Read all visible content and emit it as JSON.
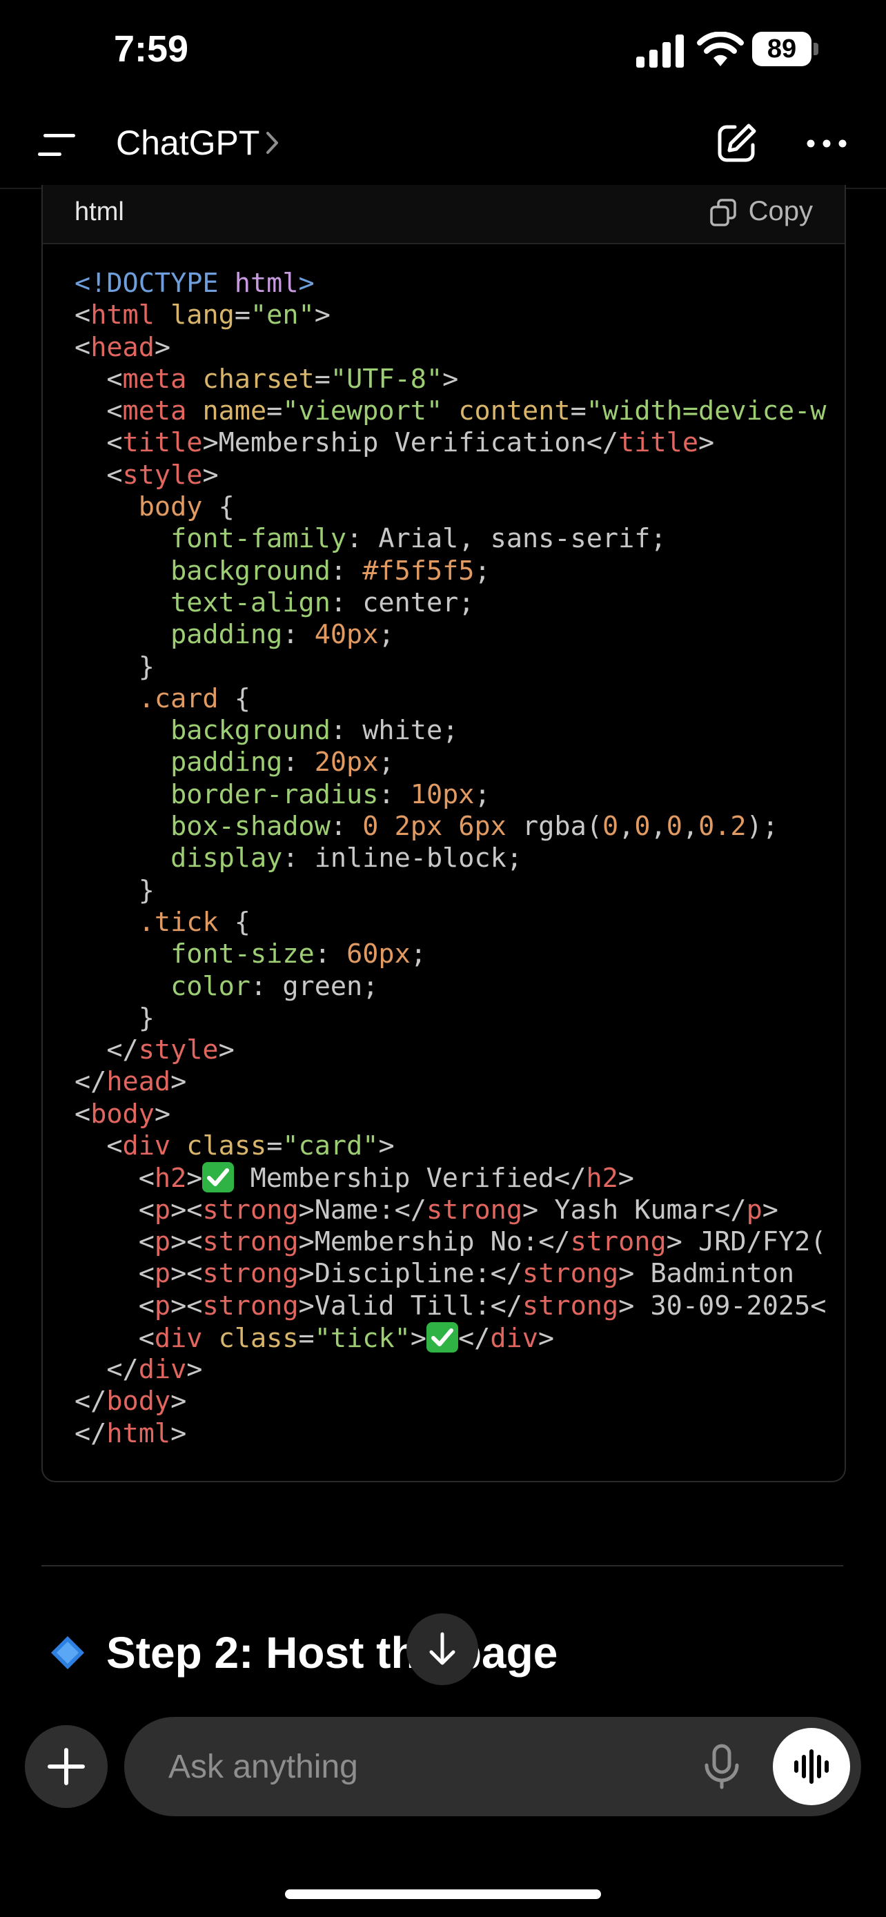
{
  "status_bar": {
    "time": "7:59",
    "battery": "89"
  },
  "header": {
    "title": "ChatGPT"
  },
  "code_block": {
    "language": "html",
    "copy_label": "Copy",
    "lines": [
      [
        [
          "t-doct",
          "<!DOCTYPE "
        ],
        [
          "t-kw",
          "html"
        ],
        [
          "t-doct",
          ">"
        ]
      ],
      [
        [
          "t-txt",
          "<"
        ],
        [
          "t-tag",
          "html"
        ],
        [
          "t-txt",
          " "
        ],
        [
          "t-attr",
          "lang"
        ],
        [
          "t-txt",
          "="
        ],
        [
          "t-str",
          "\"en\""
        ],
        [
          "t-txt",
          ">"
        ]
      ],
      [
        [
          "t-txt",
          "<"
        ],
        [
          "t-tag",
          "head"
        ],
        [
          "t-txt",
          ">"
        ]
      ],
      [
        [
          "t-txt",
          "  <"
        ],
        [
          "t-tag",
          "meta"
        ],
        [
          "t-txt",
          " "
        ],
        [
          "t-attr",
          "charset"
        ],
        [
          "t-txt",
          "="
        ],
        [
          "t-str",
          "\"UTF-8\""
        ],
        [
          "t-txt",
          ">"
        ]
      ],
      [
        [
          "t-txt",
          "  <"
        ],
        [
          "t-tag",
          "meta"
        ],
        [
          "t-txt",
          " "
        ],
        [
          "t-attr",
          "name"
        ],
        [
          "t-txt",
          "="
        ],
        [
          "t-str",
          "\"viewport\""
        ],
        [
          "t-txt",
          " "
        ],
        [
          "t-attr",
          "content"
        ],
        [
          "t-txt",
          "="
        ],
        [
          "t-str",
          "\"width=device-w"
        ]
      ],
      [
        [
          "t-txt",
          "  <"
        ],
        [
          "t-tag",
          "title"
        ],
        [
          "t-txt",
          ">Membership Verification</"
        ],
        [
          "t-tag",
          "title"
        ],
        [
          "t-txt",
          ">"
        ]
      ],
      [
        [
          "t-txt",
          "  <"
        ],
        [
          "t-tag",
          "style"
        ],
        [
          "t-txt",
          ">"
        ]
      ],
      [
        [
          "t-txt",
          "    "
        ],
        [
          "t-sel",
          "body"
        ],
        [
          "t-txt",
          " {"
        ]
      ],
      [
        [
          "t-txt",
          "      "
        ],
        [
          "t-prop",
          "font-family"
        ],
        [
          "t-txt",
          ": Arial, sans-serif;"
        ]
      ],
      [
        [
          "t-txt",
          "      "
        ],
        [
          "t-prop",
          "background"
        ],
        [
          "t-txt",
          ": "
        ],
        [
          "t-num",
          "#f5f5f5"
        ],
        [
          "t-txt",
          ";"
        ]
      ],
      [
        [
          "t-txt",
          "      "
        ],
        [
          "t-prop",
          "text-align"
        ],
        [
          "t-txt",
          ": center;"
        ]
      ],
      [
        [
          "t-txt",
          "      "
        ],
        [
          "t-prop",
          "padding"
        ],
        [
          "t-txt",
          ": "
        ],
        [
          "t-num",
          "40px"
        ],
        [
          "t-txt",
          ";"
        ]
      ],
      [
        [
          "t-txt",
          "    }"
        ]
      ],
      [
        [
          "t-txt",
          "    "
        ],
        [
          "t-sel",
          ".card"
        ],
        [
          "t-txt",
          " {"
        ]
      ],
      [
        [
          "t-txt",
          "      "
        ],
        [
          "t-prop",
          "background"
        ],
        [
          "t-txt",
          ": white;"
        ]
      ],
      [
        [
          "t-txt",
          "      "
        ],
        [
          "t-prop",
          "padding"
        ],
        [
          "t-txt",
          ": "
        ],
        [
          "t-num",
          "20px"
        ],
        [
          "t-txt",
          ";"
        ]
      ],
      [
        [
          "t-txt",
          "      "
        ],
        [
          "t-prop",
          "border-radius"
        ],
        [
          "t-txt",
          ": "
        ],
        [
          "t-num",
          "10px"
        ],
        [
          "t-txt",
          ";"
        ]
      ],
      [
        [
          "t-txt",
          "      "
        ],
        [
          "t-prop",
          "box-shadow"
        ],
        [
          "t-txt",
          ": "
        ],
        [
          "t-num",
          "0 2px 6px"
        ],
        [
          "t-txt",
          " rgba("
        ],
        [
          "t-num",
          "0"
        ],
        [
          "t-txt",
          ","
        ],
        [
          "t-num",
          "0"
        ],
        [
          "t-txt",
          ","
        ],
        [
          "t-num",
          "0"
        ],
        [
          "t-txt",
          ","
        ],
        [
          "t-num",
          "0.2"
        ],
        [
          "t-txt",
          ");"
        ]
      ],
      [
        [
          "t-txt",
          "      "
        ],
        [
          "t-prop",
          "display"
        ],
        [
          "t-txt",
          ": inline-block;"
        ]
      ],
      [
        [
          "t-txt",
          "    }"
        ]
      ],
      [
        [
          "t-txt",
          "    "
        ],
        [
          "t-sel",
          ".tick"
        ],
        [
          "t-txt",
          " {"
        ]
      ],
      [
        [
          "t-txt",
          "      "
        ],
        [
          "t-prop",
          "font-size"
        ],
        [
          "t-txt",
          ": "
        ],
        [
          "t-num",
          "60px"
        ],
        [
          "t-txt",
          ";"
        ]
      ],
      [
        [
          "t-txt",
          "      "
        ],
        [
          "t-prop",
          "color"
        ],
        [
          "t-txt",
          ": green;"
        ]
      ],
      [
        [
          "t-txt",
          "    }"
        ]
      ],
      [
        [
          "t-txt",
          "  </"
        ],
        [
          "t-tag",
          "style"
        ],
        [
          "t-txt",
          ">"
        ]
      ],
      [
        [
          "t-txt",
          "</"
        ],
        [
          "t-tag",
          "head"
        ],
        [
          "t-txt",
          ">"
        ]
      ],
      [
        [
          "t-txt",
          "<"
        ],
        [
          "t-tag",
          "body"
        ],
        [
          "t-txt",
          ">"
        ]
      ],
      [
        [
          "t-txt",
          "  <"
        ],
        [
          "t-tag",
          "div"
        ],
        [
          "t-txt",
          " "
        ],
        [
          "t-attr",
          "class"
        ],
        [
          "t-txt",
          "="
        ],
        [
          "t-str",
          "\"card\""
        ],
        [
          "t-txt",
          ">"
        ]
      ],
      [
        [
          "t-txt",
          "    <"
        ],
        [
          "t-tag",
          "h2"
        ],
        [
          "t-txt",
          ">"
        ],
        [
          "emoji",
          "✅"
        ],
        [
          "t-txt",
          " Membership Verified</"
        ],
        [
          "t-tag",
          "h2"
        ],
        [
          "t-txt",
          ">"
        ]
      ],
      [
        [
          "t-txt",
          "    <"
        ],
        [
          "t-tag",
          "p"
        ],
        [
          "t-txt",
          "><"
        ],
        [
          "t-tag",
          "strong"
        ],
        [
          "t-txt",
          ">Name:</"
        ],
        [
          "t-tag",
          "strong"
        ],
        [
          "t-txt",
          "> Yash Kumar</"
        ],
        [
          "t-tag",
          "p"
        ],
        [
          "t-txt",
          ">"
        ]
      ],
      [
        [
          "t-txt",
          "    <"
        ],
        [
          "t-tag",
          "p"
        ],
        [
          "t-txt",
          "><"
        ],
        [
          "t-tag",
          "strong"
        ],
        [
          "t-txt",
          ">Membership No:</"
        ],
        [
          "t-tag",
          "strong"
        ],
        [
          "t-txt",
          "> JRD/FY2("
        ]
      ],
      [
        [
          "t-txt",
          "    <"
        ],
        [
          "t-tag",
          "p"
        ],
        [
          "t-txt",
          "><"
        ],
        [
          "t-tag",
          "strong"
        ],
        [
          "t-txt",
          ">Discipline:</"
        ],
        [
          "t-tag",
          "strong"
        ],
        [
          "t-txt",
          "> Badminton"
        ]
      ],
      [
        [
          "t-txt",
          "    <"
        ],
        [
          "t-tag",
          "p"
        ],
        [
          "t-txt",
          "><"
        ],
        [
          "t-tag",
          "strong"
        ],
        [
          "t-txt",
          ">Valid Till:</"
        ],
        [
          "t-tag",
          "strong"
        ],
        [
          "t-txt",
          "> 30-09-2025<"
        ]
      ],
      [
        [
          "t-txt",
          "    <"
        ],
        [
          "t-tag",
          "div"
        ],
        [
          "t-txt",
          " "
        ],
        [
          "t-attr",
          "class"
        ],
        [
          "t-txt",
          "="
        ],
        [
          "t-str",
          "\"tick\""
        ],
        [
          "t-txt",
          ">"
        ],
        [
          "emoji",
          "✅"
        ],
        [
          "t-txt",
          "</"
        ],
        [
          "t-tag",
          "div"
        ],
        [
          "t-txt",
          ">"
        ]
      ],
      [
        [
          "t-txt",
          "  </"
        ],
        [
          "t-tag",
          "div"
        ],
        [
          "t-txt",
          ">"
        ]
      ],
      [
        [
          "t-txt",
          "</"
        ],
        [
          "t-tag",
          "body"
        ],
        [
          "t-txt",
          ">"
        ]
      ],
      [
        [
          "t-txt",
          "</"
        ],
        [
          "t-tag",
          "html"
        ],
        [
          "t-txt",
          ">"
        ]
      ]
    ]
  },
  "step_heading": "Step 2: Host the page",
  "composer": {
    "placeholder": "Ask anything"
  },
  "colors": {
    "background": "#000000",
    "composer": "#2f2f2f",
    "emoji_green": "#2fb344"
  }
}
